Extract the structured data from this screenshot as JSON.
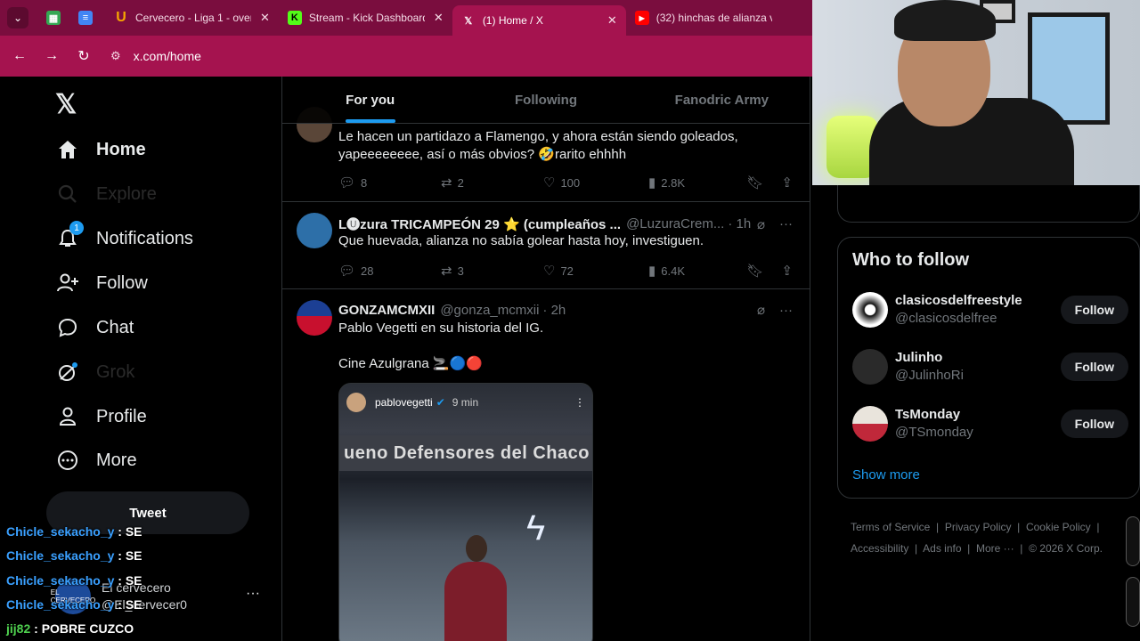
{
  "browser": {
    "tabs": [
      {
        "title": "",
        "icon": "tab-switcher-icon"
      },
      {
        "title": "",
        "icon": "sheets-icon",
        "color": "#34a853"
      },
      {
        "title": "",
        "icon": "docs-icon",
        "color": "#4285f4"
      },
      {
        "title": "Cervecero - Liga 1 - over",
        "icon": "u-icon",
        "color": "#f7a600"
      },
      {
        "title": "Stream - Kick Dashboard",
        "icon": "kick-icon",
        "color": "#53fc18"
      },
      {
        "title": "(1) Home / X",
        "icon": "x-icon",
        "color": "#000000"
      },
      {
        "title": "(32) hinchas de alianza v",
        "icon": "youtube-icon",
        "color": "#ff0000"
      }
    ],
    "url": "x.com/home"
  },
  "nav": {
    "items": [
      {
        "label": "Home",
        "icon": "home-icon"
      },
      {
        "label": "Explore",
        "icon": "search-icon"
      },
      {
        "label": "Notifications",
        "icon": "bell-icon",
        "badge": "1"
      },
      {
        "label": "Follow",
        "icon": "follow-icon"
      },
      {
        "label": "Chat",
        "icon": "chat-icon"
      },
      {
        "label": "Grok",
        "icon": "grok-icon"
      },
      {
        "label": "Profile",
        "icon": "profile-icon"
      },
      {
        "label": "More",
        "icon": "more-icon"
      }
    ],
    "tweet_label": "Tweet",
    "account": {
      "name": "El cervecero",
      "handle": "@El_cervecer0",
      "avatar_text": "EL CERVECERO"
    }
  },
  "chat": [
    {
      "user": "Chicle_sekacho_y",
      "msg": ": SE"
    },
    {
      "user": "Chicle_sekacho_y",
      "msg": ": SE"
    },
    {
      "user": "Chicle_sekacho_y",
      "msg": ": SE"
    },
    {
      "user": "Chicle_sekacho_y",
      "msg": ": SE"
    },
    {
      "user": "jij82",
      "msg": ": POBRE CUZCO"
    }
  ],
  "timeline": {
    "tabs": [
      "For you",
      "Following",
      "Fanodric Army"
    ],
    "posts": [
      {
        "name": "",
        "handle": "",
        "time": "",
        "text": "Le hacen un partidazo a Flamengo, y ahora están siendo goleados, yapeeeeeeee, así o más obvios? 🤣rarito  ehhhh",
        "replies": "8",
        "reposts": "2",
        "likes": "100",
        "views": "2.8K"
      },
      {
        "name": "L🅤zura TRICAMPEÓN 29 ⭐ (cumpleaños ...",
        "handle": "@LuzuraCrem...",
        "time": "· 1h",
        "text": "Que huevada, alianza no sabía golear hasta hoy, investiguen.",
        "replies": "28",
        "reposts": "3",
        "likes": "72",
        "views": "6.4K"
      },
      {
        "name": "GONZAMCMXII",
        "handle": "@gonza_mcmxii",
        "time": "· 2h",
        "text": "Pablo Vegetti en su historia del IG.",
        "text2": "Cine Azulgrana 🚬🔵🔴",
        "media": {
          "user": "pablovegetti",
          "time": "9 min",
          "banner": "ueno Defensores del Chaco"
        }
      }
    ]
  },
  "sidebar": {
    "show_more_top": "Show more",
    "who_to_follow": {
      "title": "Who to follow",
      "accounts": [
        {
          "name": "clasicosdelfreestyle",
          "handle": "@clasicosdelfree",
          "button": "Follow"
        },
        {
          "name": "Julinho",
          "handle": "@JulinhoRi",
          "button": "Follow"
        },
        {
          "name": "TsMonday",
          "handle": "@TSmonday",
          "button": "Follow"
        }
      ],
      "show_more": "Show more"
    },
    "footer": {
      "line1": [
        "Terms of Service",
        "Privacy Policy",
        "Cookie Policy"
      ],
      "line2": [
        "Accessibility",
        "Ads info",
        "More ···",
        "© 2026 X Corp."
      ]
    }
  },
  "colors": {
    "accent": "#1d9bf0",
    "tabbar": "#7a0d3e",
    "addressbar": "#a5134f"
  }
}
